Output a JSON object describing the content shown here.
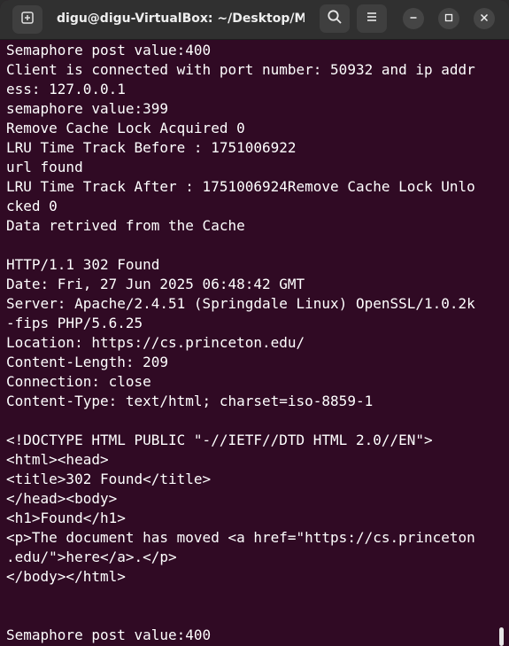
{
  "window": {
    "title": "digu@digu-VirtualBox: ~/Desktop/M..."
  },
  "terminal": {
    "lines": [
      "Semaphore post value:400",
      "Client is connected with port number: 50932 and ip addr",
      "ess: 127.0.0.1",
      "semaphore value:399",
      "Remove Cache Lock Acquired 0",
      "LRU Time Track Before : 1751006922",
      "url found",
      "LRU Time Track After : 1751006924Remove Cache Lock Unlo",
      "cked 0",
      "Data retrived from the Cache",
      "",
      "HTTP/1.1 302 Found",
      "Date: Fri, 27 Jun 2025 06:48:42 GMT",
      "Server: Apache/2.4.51 (Springdale Linux) OpenSSL/1.0.2k",
      "-fips PHP/5.6.25",
      "Location: https://cs.princeton.edu/",
      "Content-Length: 209",
      "Connection: close",
      "Content-Type: text/html; charset=iso-8859-1",
      "",
      "<!DOCTYPE HTML PUBLIC \"-//IETF//DTD HTML 2.0//EN\">",
      "<html><head>",
      "<title>302 Found</title>",
      "</head><body>",
      "<h1>Found</h1>",
      "<p>The document has moved <a href=\"https://cs.princeton",
      ".edu/\">here</a>.</p>",
      "</body></html>",
      "",
      "",
      "Semaphore post value:400"
    ]
  }
}
